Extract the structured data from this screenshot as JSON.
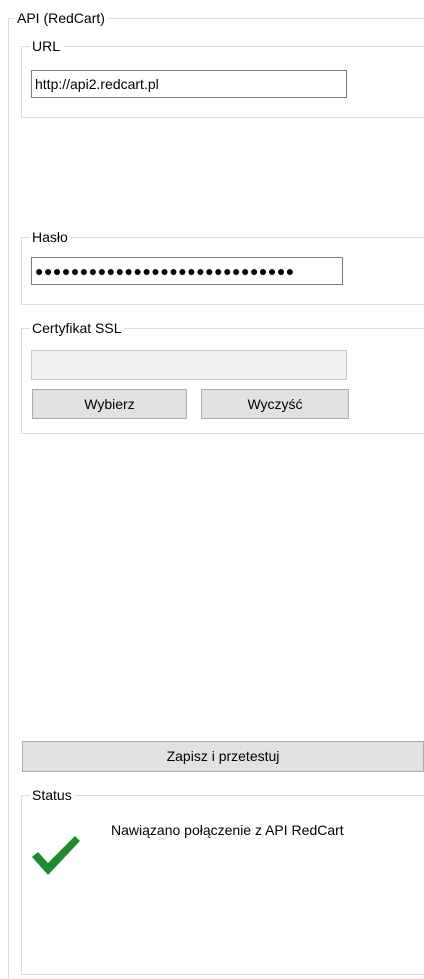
{
  "api_group": {
    "title": "API (RedCart)"
  },
  "url_group": {
    "title": "URL",
    "value": "http://api2.redcart.pl"
  },
  "password_group": {
    "title": "Hasło",
    "value": "●●●●●●●●●●●●●●●●●●●●●●●●●●●●●"
  },
  "ssl_group": {
    "title": "Certyfikat SSL",
    "path_value": "",
    "choose_label": "Wybierz",
    "clear_label": "Wyczyść"
  },
  "save_test_label": "Zapisz i przetestuj",
  "status_group": {
    "title": "Status",
    "message": "Nawiązano połączenie z API RedCart",
    "icon": "checkmark-icon",
    "icon_color": "#1e8c2c"
  }
}
